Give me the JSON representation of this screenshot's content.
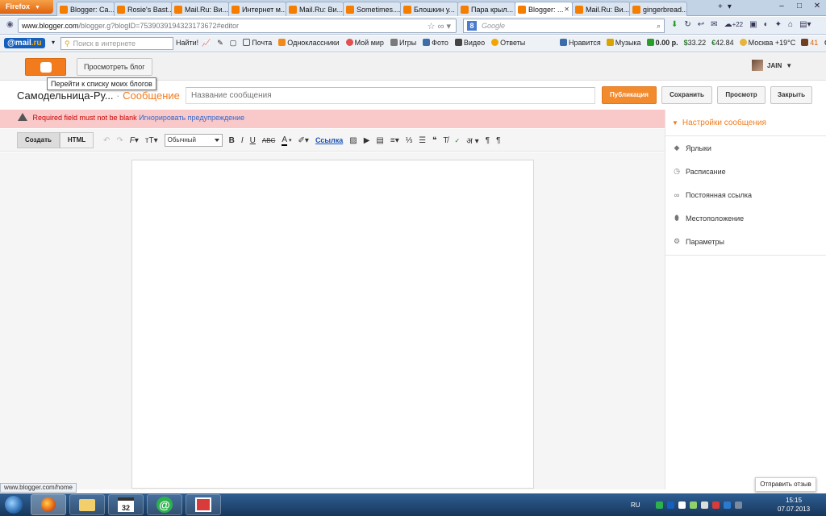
{
  "browser": {
    "menu_label": "Firefox",
    "tabs": [
      {
        "label": "Blogger: Ca...",
        "active": false
      },
      {
        "label": "Rosie's Bast...",
        "active": false
      },
      {
        "label": "Mail.Ru: Ви...",
        "active": false
      },
      {
        "label": "Интернет м...",
        "active": false
      },
      {
        "label": "Mail.Ru: Ви...",
        "active": false
      },
      {
        "label": "Sometimes....",
        "active": false
      },
      {
        "label": "Блошкин у...",
        "active": false
      },
      {
        "label": "Пара крыл...",
        "active": false
      },
      {
        "label": "Blogger: ...",
        "active": true
      },
      {
        "label": "Mail.Ru: Ви...",
        "active": false
      },
      {
        "label": "gingerbread...",
        "active": false
      }
    ],
    "url_host": "www.blogger.com",
    "url_path": "/blogger.g?blogID=7539039194323173672#editor",
    "search_engine_placeholder": "Google",
    "weather_badge": "+22"
  },
  "mailru_toolbar": {
    "brand": "@mail",
    "brand_suffix": ".ru",
    "search_placeholder": "Поиск в интернете",
    "find_label": "Найти!",
    "links": [
      "Почта",
      "Одноклассники",
      "Мой мир",
      "Игры",
      "Фото",
      "Видео",
      "Ответы"
    ],
    "like_label": "Нравится",
    "music_label": "Музыка",
    "balance": "0.00 р.",
    "usd": "33.22",
    "eur": "42.84",
    "weather": "Москва +19°C",
    "badge_count": "41"
  },
  "blogger": {
    "view_blog_label": "Просмотреть блог",
    "tooltip": "Перейти к списку моих блогов",
    "user_name": "JAIN",
    "blog_name": "Самодельница-Ру...",
    "separator": "·",
    "post_label": "Сообщение",
    "title_placeholder": "Название сообщения",
    "buttons": {
      "publish": "Публикация",
      "save": "Сохранить",
      "preview": "Просмотр",
      "close": "Закрыть"
    },
    "error_message": "Required field must not be blank",
    "error_ignore": "Игнорировать предупреждение",
    "mode_compose": "Создать",
    "mode_html": "HTML",
    "format_select": "Обычный",
    "link_label": "Ссылка",
    "sidebar": {
      "header": "Настройки сообщения",
      "items": [
        {
          "label": "Ярлыки",
          "icon": "tag-icon"
        },
        {
          "label": "Расписание",
          "icon": "clock-icon"
        },
        {
          "label": "Постоянная ссылка",
          "icon": "link-icon"
        },
        {
          "label": "Местоположение",
          "icon": "pin-icon"
        },
        {
          "label": "Параметры",
          "icon": "gear-icon"
        }
      ]
    },
    "feedback_label": "Отправить отзыв"
  },
  "status_url": "www.blogger.com/home",
  "taskbar": {
    "calendar_day": "32",
    "lang": "RU",
    "time": "15:15",
    "date": "07.07.2013"
  },
  "colors": {
    "accent": "#f27b1d",
    "error_bg": "#f9c9c9",
    "link": "#3366cc"
  }
}
